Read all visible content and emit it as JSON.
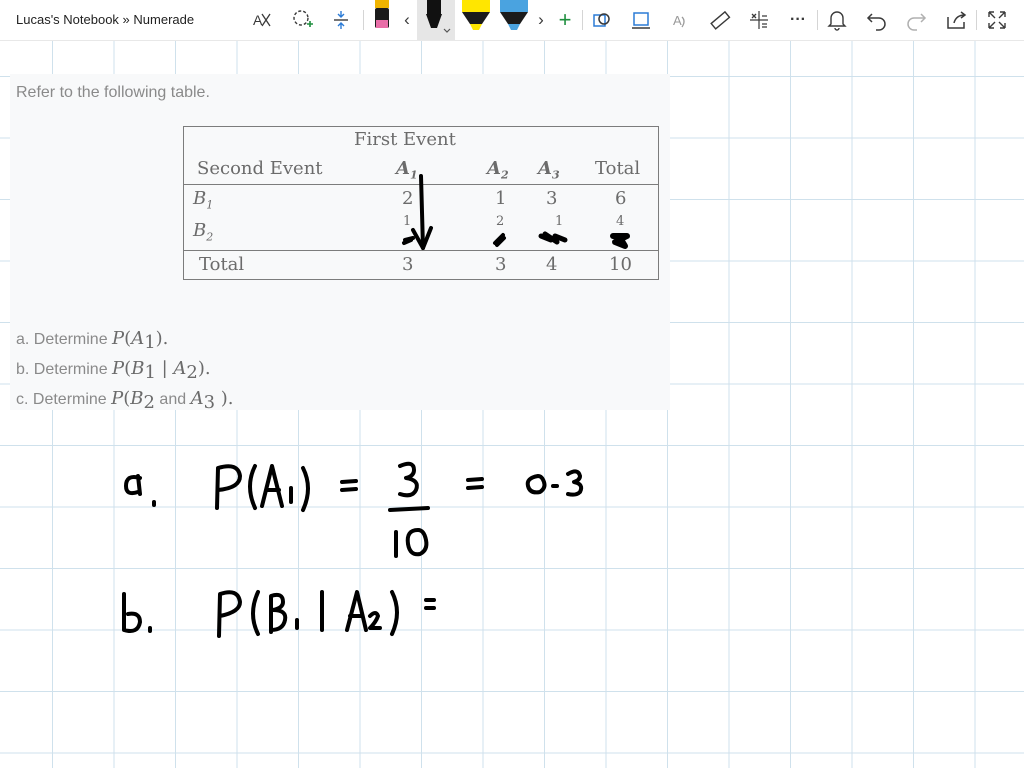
{
  "app": {
    "title": "Lucas's Notebook » Numerade"
  },
  "toolbar": {
    "icons": [
      "text-to-math-icon",
      "lasso-select-icon",
      "insert-space-icon",
      "pen-pink",
      "scroll-left-icon",
      "pen-black",
      "highlighter-yellow",
      "highlighter-blue",
      "scroll-right-icon",
      "add-pen-icon",
      "shape-recognition-icon",
      "ink-to-shape-icon",
      "ink-to-text-icon",
      "ruler-icon",
      "math-icon",
      "more-icon",
      "notifications-icon",
      "undo-icon",
      "redo-icon",
      "share-icon",
      "fullscreen-icon"
    ],
    "more_label": "···",
    "add_label": "+",
    "left_arrow": "‹",
    "right_arrow": "›"
  },
  "problem": {
    "intro": "Refer to the following table.",
    "table": {
      "group_header": "First Event",
      "row_header": "Second Event",
      "col_headers": [
        "A",
        "A",
        "A",
        "Total"
      ],
      "col_subs": [
        "1",
        "2",
        "3",
        ""
      ],
      "rows": [
        {
          "label": "B",
          "sub": "1",
          "values": [
            "2",
            "1",
            "3",
            "6"
          ]
        },
        {
          "label": "B",
          "sub": "2",
          "values": [
            "1",
            "2",
            "1",
            "4"
          ]
        },
        {
          "label": "Total",
          "sub": "",
          "values": [
            "3",
            "3",
            "4",
            "10"
          ]
        }
      ]
    },
    "questions": [
      {
        "prefix": "a. Determine ",
        "math": "P",
        "open": "(",
        "var": "A",
        "sub": "1",
        "close": ").",
        "mid": "",
        "var2": "",
        "sub2": ""
      },
      {
        "prefix": "b. Determine ",
        "math": "P",
        "open": "(",
        "var": "B",
        "sub": "1",
        "mid": " | ",
        "var2": "A",
        "sub2": "2",
        "close": ")."
      },
      {
        "prefix": "c. Determine ",
        "math": "P",
        "open": "(",
        "var": "B",
        "sub": "2",
        "mid": " and ",
        "var2": "A",
        "sub2": "3",
        "close": " )."
      }
    ]
  },
  "colors": {
    "ink": "#000000",
    "grid": "#cfe1ec",
    "card": "#f8f9fa",
    "pen_pink": "#e86fa8",
    "highlighter_yellow": "#ffe600",
    "highlighter_blue": "#4aa3e0",
    "accent_green": "#1e8e3e",
    "accent_blue": "#2b7bd6"
  }
}
